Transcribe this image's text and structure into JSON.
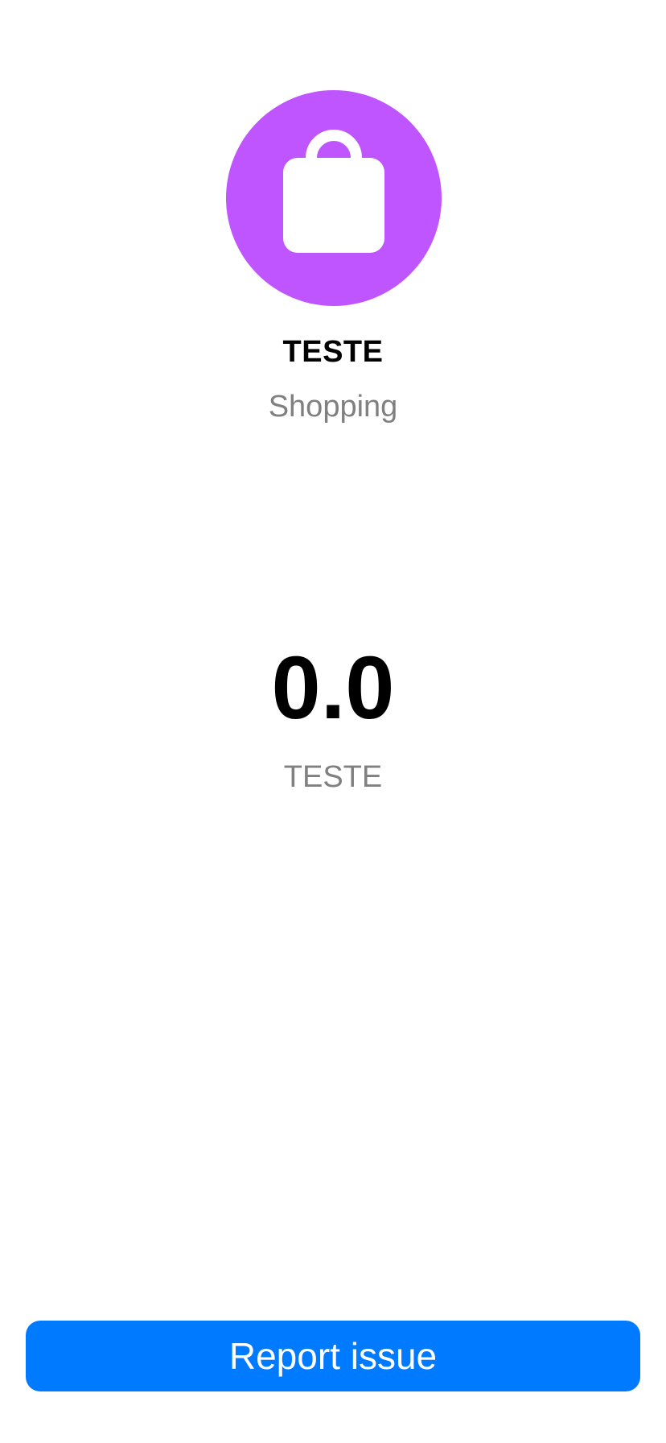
{
  "header": {
    "icon": "shopping-bag-icon",
    "merchant_name": "TESTE",
    "category": "Shopping"
  },
  "amount": {
    "value": "0.0",
    "caption": "TESTE"
  },
  "actions": {
    "report_label": "Report issue"
  },
  "colors": {
    "icon_background": "#BF55FE",
    "button_background": "#007AFF",
    "secondary_text": "#808080"
  }
}
